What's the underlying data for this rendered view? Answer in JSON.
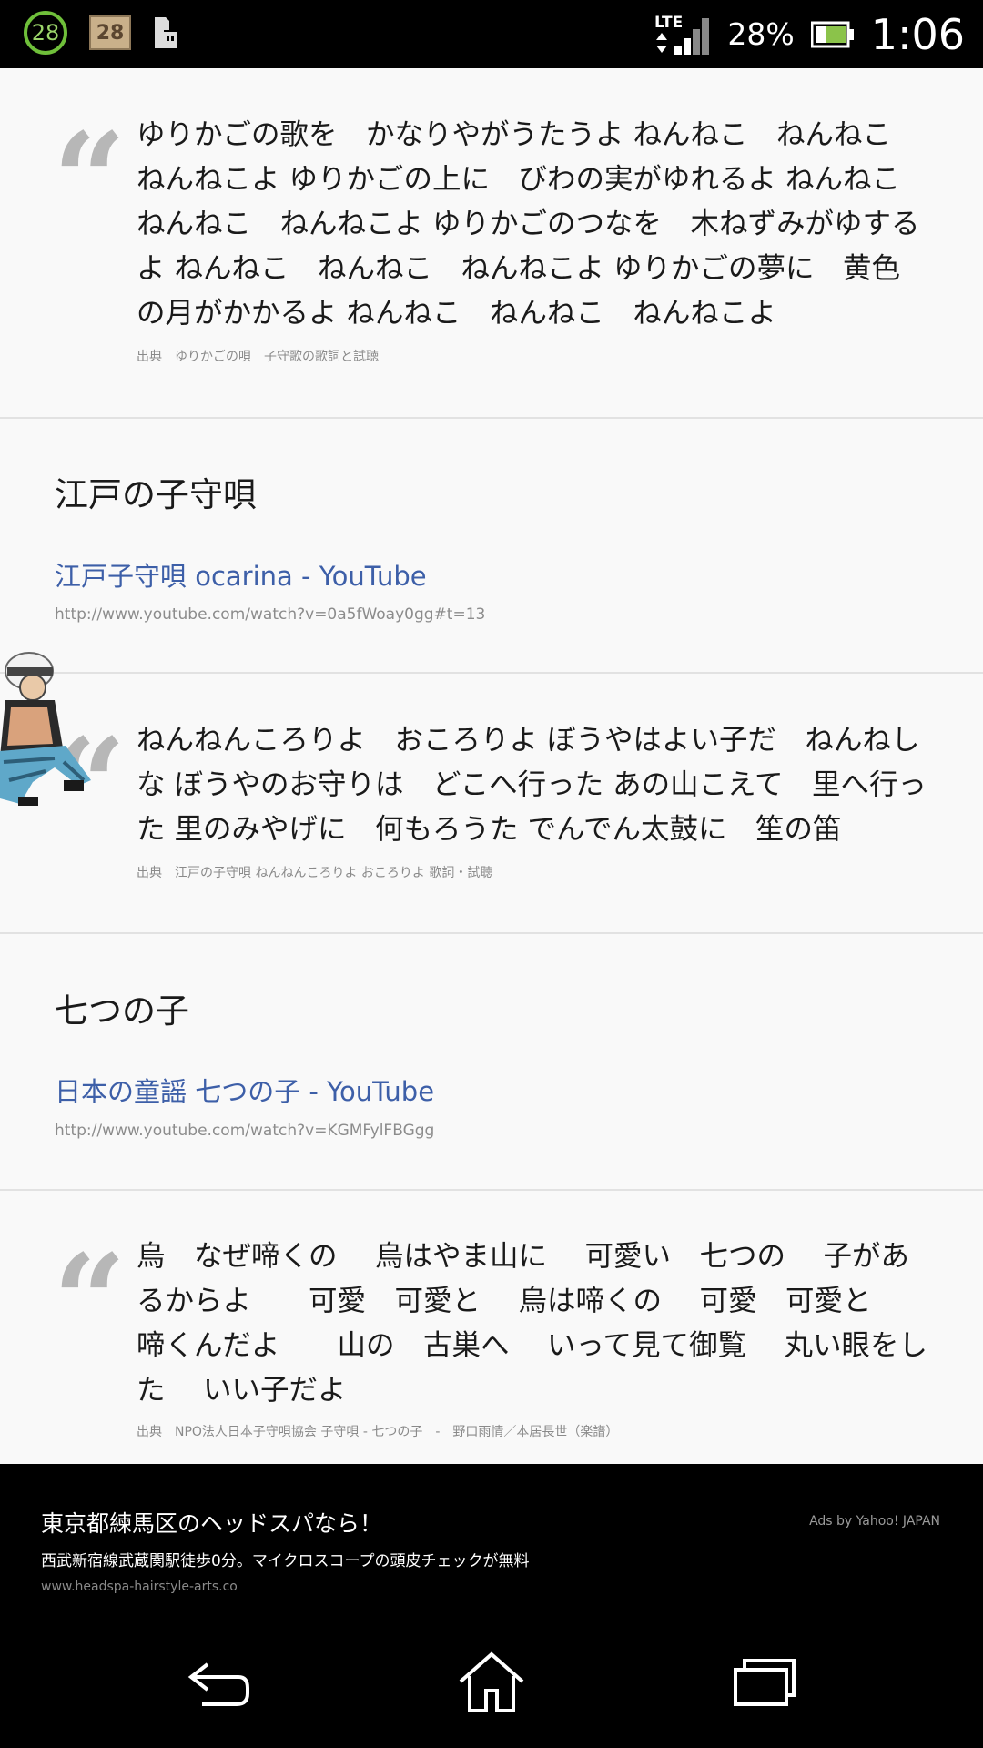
{
  "status_bar": {
    "notif_count": "28",
    "calendar_day": "28",
    "network": "LTE",
    "battery_percent": "28%",
    "time": "1:06"
  },
  "entries": [
    {
      "quote": "ゆりかごの歌を　かなりやがうたうよ ねんねこ　ねんねこ　ねんねこよ ゆりかごの上に　びわの実がゆれるよ ねんねこ　ねんねこ　ねんねこよ ゆりかごのつなを　木ねずみがゆするよ ねんねこ　ねんねこ　ねんねこよ ゆりかごの夢に　黄色の月がかかるよ ねんねこ　ねんねこ　ねんねこよ",
      "source": "出典　ゆりかごの唄　子守歌の歌詞と試聴"
    },
    {
      "heading": "江戸の子守唄",
      "link_title": "江戸子守唄 ocarina - YouTube",
      "link_url": "http://www.youtube.com/watch?v=0a5fWoay0gg#t=13",
      "quote": "ねんねんころりよ　おころりよ ぼうやはよい子だ　ねんねしな ぼうやのお守りは　どこへ行った あの山こえて　里へ行った 里のみやげに　何もろうた でんでん太鼓に　笙の笛",
      "source": "出典　江戸の子守唄 ねんねんころりよ おころりよ 歌詞・試聴"
    },
    {
      "heading": "七つの子",
      "link_title": "日本の童謡 七つの子 - YouTube",
      "link_url": "http://www.youtube.com/watch?v=KGMFylFBGgg",
      "quote": "烏　なぜ啼くの　 烏はやま山に　 可愛い　七つの　 子があるからよ　　可愛　可愛と　 烏は啼くの　 可愛　可愛と　 啼くんだよ　　山の　古巣へ　 いって見て御覧　 丸い眼をした　 いい子だよ",
      "source": "出典　NPO法人日本子守唄協会 子守唄 - 七つの子　-　野口雨情／本居長世（楽譜）"
    }
  ],
  "ad": {
    "title": "東京都練馬区のヘッドスパなら！",
    "description": "西武新宿線武蔵関駅徒歩0分。マイクロスコープの頭皮チェックが無料",
    "url": "www.headspa-hairstyle-arts.co",
    "ads_by": "Ads by Yahoo! JAPAN"
  },
  "icons": {
    "quote": "quote-mark-icon",
    "back": "back-icon",
    "home": "home-icon",
    "recents": "recent-apps-icon"
  },
  "colors": {
    "link": "#3d5fa8",
    "quote_mark": "#b7b7b7"
  }
}
